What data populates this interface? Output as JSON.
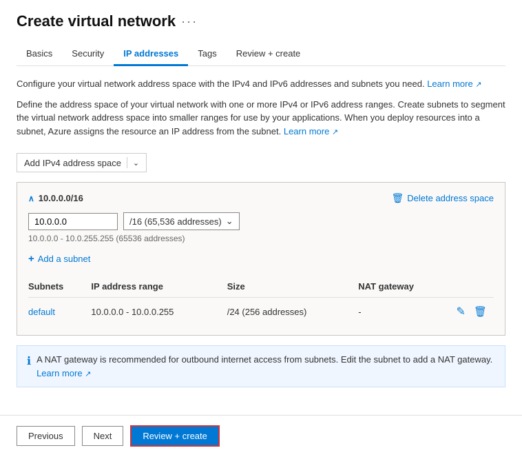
{
  "page": {
    "title": "Create virtual network",
    "more_icon": "···"
  },
  "tabs": [
    {
      "id": "basics",
      "label": "Basics",
      "active": false
    },
    {
      "id": "security",
      "label": "Security",
      "active": false
    },
    {
      "id": "ip-addresses",
      "label": "IP addresses",
      "active": true
    },
    {
      "id": "tags",
      "label": "Tags",
      "active": false
    },
    {
      "id": "review-create",
      "label": "Review + create",
      "active": false
    }
  ],
  "descriptions": {
    "line1_prefix": "Configure your virtual network address space with the IPv4 and IPv6 addresses and subnets you need.",
    "line1_link": "Learn more",
    "line2": "Define the address space of your virtual network with one or more IPv4 or IPv6 address ranges. Create subnets to segment the virtual network address space into smaller ranges for use by your applications. When you deploy resources into a subnet, Azure assigns the resource an IP address from the subnet.",
    "line2_link": "Learn more"
  },
  "add_address_space_btn": "Add IPv4 address space",
  "address_space": {
    "cidr": "10.0.0.0/16",
    "ip": "10.0.0.0",
    "mask": "/16 (65,536 addresses)",
    "hint": "10.0.0.0 - 10.0.255.255 (65536 addresses)",
    "delete_label": "Delete address space",
    "add_subnet_label": "Add a subnet"
  },
  "subnets_table": {
    "columns": [
      "Subnets",
      "IP address range",
      "Size",
      "NAT gateway"
    ],
    "rows": [
      {
        "name": "default",
        "ip_range": "10.0.0.0 - 10.0.0.255",
        "size": "/24 (256 addresses)",
        "nat_gateway": "-"
      }
    ]
  },
  "info_bar": {
    "text": "A NAT gateway is recommended for outbound internet access from subnets. Edit the subnet to add a NAT gateway.",
    "learn_label": "Learn more"
  },
  "footer": {
    "previous_label": "Previous",
    "next_label": "Next",
    "review_create_label": "Review + create"
  },
  "icons": {
    "chevron_down": "⌄",
    "collapse": "∧",
    "delete": "🗑",
    "edit": "✎",
    "info": "ℹ",
    "plus": "+",
    "external_link": "↗"
  }
}
